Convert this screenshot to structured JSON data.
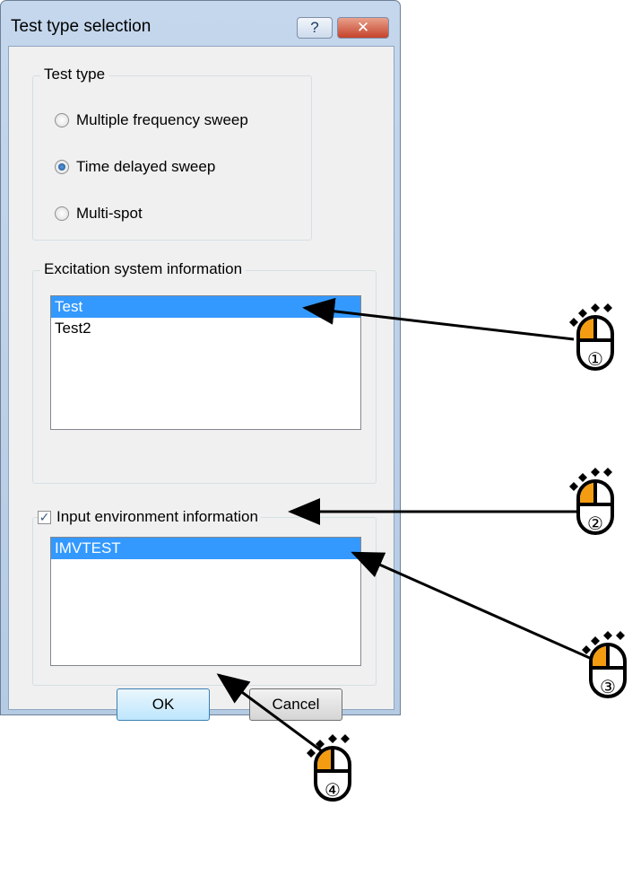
{
  "window": {
    "title": "Test type selection",
    "help_glyph": "?",
    "close_glyph": "✕"
  },
  "test_type": {
    "group_label": "Test type",
    "options": [
      {
        "label": "Multiple frequency sweep",
        "checked": false
      },
      {
        "label": "Time delayed sweep",
        "checked": true
      },
      {
        "label": "Multi-spot",
        "checked": false
      }
    ]
  },
  "excitation": {
    "group_label": "Excitation system information",
    "items": [
      "Test",
      "Test2"
    ],
    "selected": "Test"
  },
  "input_env": {
    "checkbox_label": "Input environment information",
    "checked": true,
    "items": [
      "IMVTEST"
    ],
    "selected": "IMVTEST"
  },
  "buttons": {
    "ok": "OK",
    "cancel": "Cancel"
  },
  "annotations": {
    "step_labels": [
      "①",
      "②",
      "③",
      "④"
    ],
    "colors": {
      "mouse_fill": "#f39c12",
      "arrow": "#000000",
      "selection": "#3399ff"
    }
  }
}
